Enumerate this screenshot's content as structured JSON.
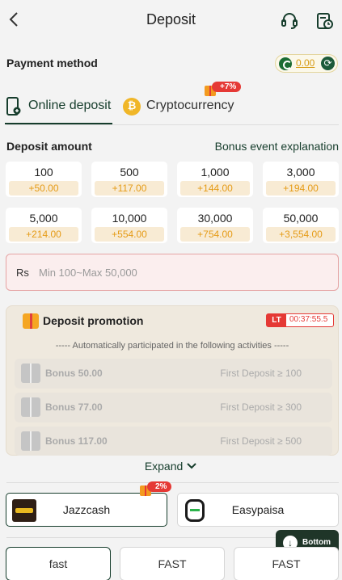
{
  "header": {
    "title": "Deposit"
  },
  "payment_method": {
    "label": "Payment method",
    "balance": "0.00"
  },
  "tabs": [
    {
      "label": "Online deposit"
    },
    {
      "label": "Cryptocurrency",
      "badge": "+7%"
    }
  ],
  "deposit": {
    "label": "Deposit amount",
    "bonus_link": "Bonus event explanation"
  },
  "amounts": [
    {
      "amount": "100",
      "bonus": "+50.00"
    },
    {
      "amount": "500",
      "bonus": "+117.00"
    },
    {
      "amount": "1,000",
      "bonus": "+144.00"
    },
    {
      "amount": "3,000",
      "bonus": "+194.00"
    },
    {
      "amount": "5,000",
      "bonus": "+214.00"
    },
    {
      "amount": "10,000",
      "bonus": "+554.00"
    },
    {
      "amount": "30,000",
      "bonus": "+754.00"
    },
    {
      "amount": "50,000",
      "bonus": "+3,554.00"
    }
  ],
  "input": {
    "currency": "Rs",
    "placeholder": "Min 100~Max 50,000"
  },
  "promotion": {
    "title": "Deposit promotion",
    "timer_tag": "LT",
    "timer": "00:37:55.5",
    "subtitle": "----- Automatically participated in the following activities -----",
    "rows": [
      {
        "bonus": "Bonus 50.00",
        "condition": "First Deposit ≥ 100"
      },
      {
        "bonus": "Bonus 77.00",
        "condition": "First Deposit ≥ 300"
      },
      {
        "bonus": "Bonus 117.00",
        "condition": "First Deposit ≥ 500"
      }
    ]
  },
  "expand": "Expand",
  "channels": [
    {
      "label": "Jazzcash",
      "badge": "2%"
    },
    {
      "label": "Easypaisa"
    }
  ],
  "bottom_button": "Bottom",
  "speed_options": [
    "fast",
    "FAST",
    "FAST"
  ],
  "colors": {
    "primary": "#163d2c",
    "bonus": "#e59b16",
    "badge": "#e53935"
  }
}
